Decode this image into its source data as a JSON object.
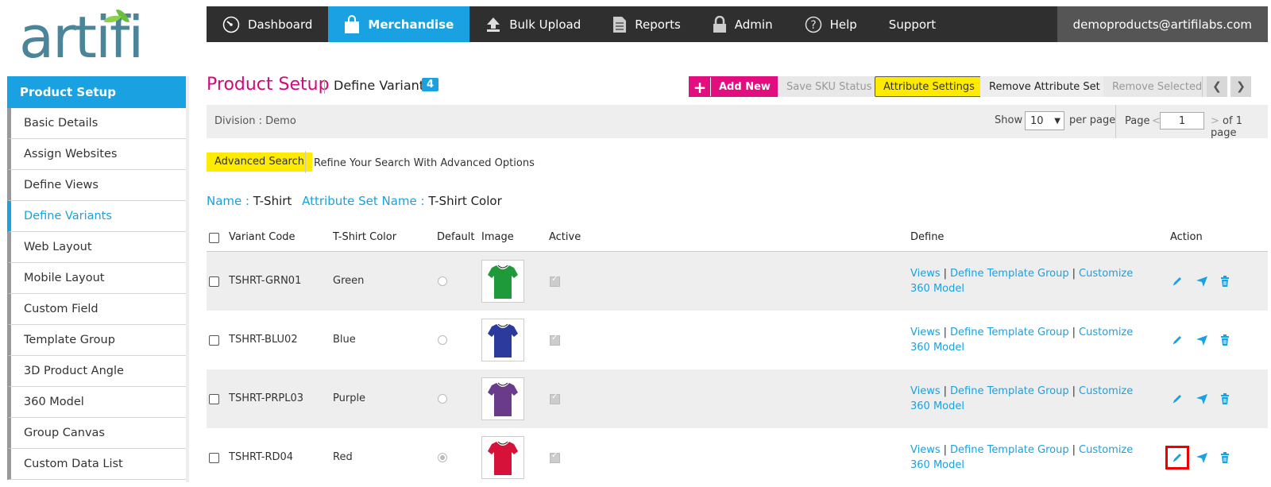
{
  "brand": {
    "logo_text": "artifi",
    "accent": "#1aa1e1",
    "title_color": "#d10a79"
  },
  "topnav": {
    "items": [
      {
        "label": "Dashboard",
        "icon": "dashboard-gauge-icon"
      },
      {
        "label": "Merchandise",
        "icon": "shopping-bag-icon",
        "active": true
      },
      {
        "label": "Bulk Upload",
        "icon": "upload-icon"
      },
      {
        "label": "Reports",
        "icon": "report-document-icon"
      },
      {
        "label": "Admin",
        "icon": "lock-icon"
      },
      {
        "label": "Help",
        "icon": "help-circle-icon"
      },
      {
        "label": "Support"
      }
    ],
    "user": "demoproducts@artifilabs.com"
  },
  "sidebar": {
    "header": "Product Setup",
    "items": [
      {
        "label": "Basic Details"
      },
      {
        "label": "Assign Websites"
      },
      {
        "label": "Define Views"
      },
      {
        "label": "Define Variants",
        "active": true
      },
      {
        "label": "Web Layout"
      },
      {
        "label": "Mobile Layout"
      },
      {
        "label": "Custom Field"
      },
      {
        "label": "Template Group"
      },
      {
        "label": "3D Product Angle"
      },
      {
        "label": "360 Model"
      },
      {
        "label": "Group Canvas"
      },
      {
        "label": "Custom Data List"
      }
    ]
  },
  "header": {
    "title": "Product Setup",
    "subtitle": "Define Variants",
    "count": "4",
    "buttons": {
      "add_new": "Add New",
      "save_sku": "Save SKU Status",
      "attribute_settings": "Attribute Settings",
      "remove_attribute_set": "Remove Attribute Set",
      "remove_selected": "Remove Selected"
    },
    "prev_arrow": "❮",
    "next_arrow": "❯"
  },
  "filter": {
    "division_label": "Division :",
    "division_value": "Demo",
    "show_label": "Show",
    "show_value": "10",
    "per_page_label": "per page",
    "page_label": "Page",
    "page_prev": "<",
    "page_value": "1",
    "page_next": ">",
    "page_total": "of 1 page"
  },
  "search": {
    "advanced_label": "Advanced Search",
    "advanced_hint": "Refine Your Search With Advanced Options"
  },
  "meta": {
    "name_label": "Name :",
    "name_value": "T-Shirt",
    "attrset_label": "Attribute Set Name :",
    "attrset_value": "T-Shirt Color"
  },
  "table": {
    "columns": {
      "variant_code": "Variant Code",
      "color": "T-Shirt Color",
      "default": "Default",
      "image": "Image",
      "active": "Active",
      "define": "Define",
      "action": "Action"
    },
    "links": {
      "views": "Views",
      "template_group": "Define Template Group",
      "customize": "Customize 360 Model"
    },
    "rows": [
      {
        "code": "TSHRT-GRN01",
        "color": "Green",
        "shirt_color": "#1e9a3a",
        "default": false,
        "active": true
      },
      {
        "code": "TSHRT-BLU02",
        "color": "Blue",
        "shirt_color": "#2b3a9c",
        "default": false,
        "active": true
      },
      {
        "code": "TSHRT-PRPL03",
        "color": "Purple",
        "shirt_color": "#6a3b8a",
        "default": false,
        "active": true
      },
      {
        "code": "TSHRT-RD04",
        "color": "Red",
        "shirt_color": "#d6123a",
        "default": true,
        "active": true
      }
    ]
  }
}
